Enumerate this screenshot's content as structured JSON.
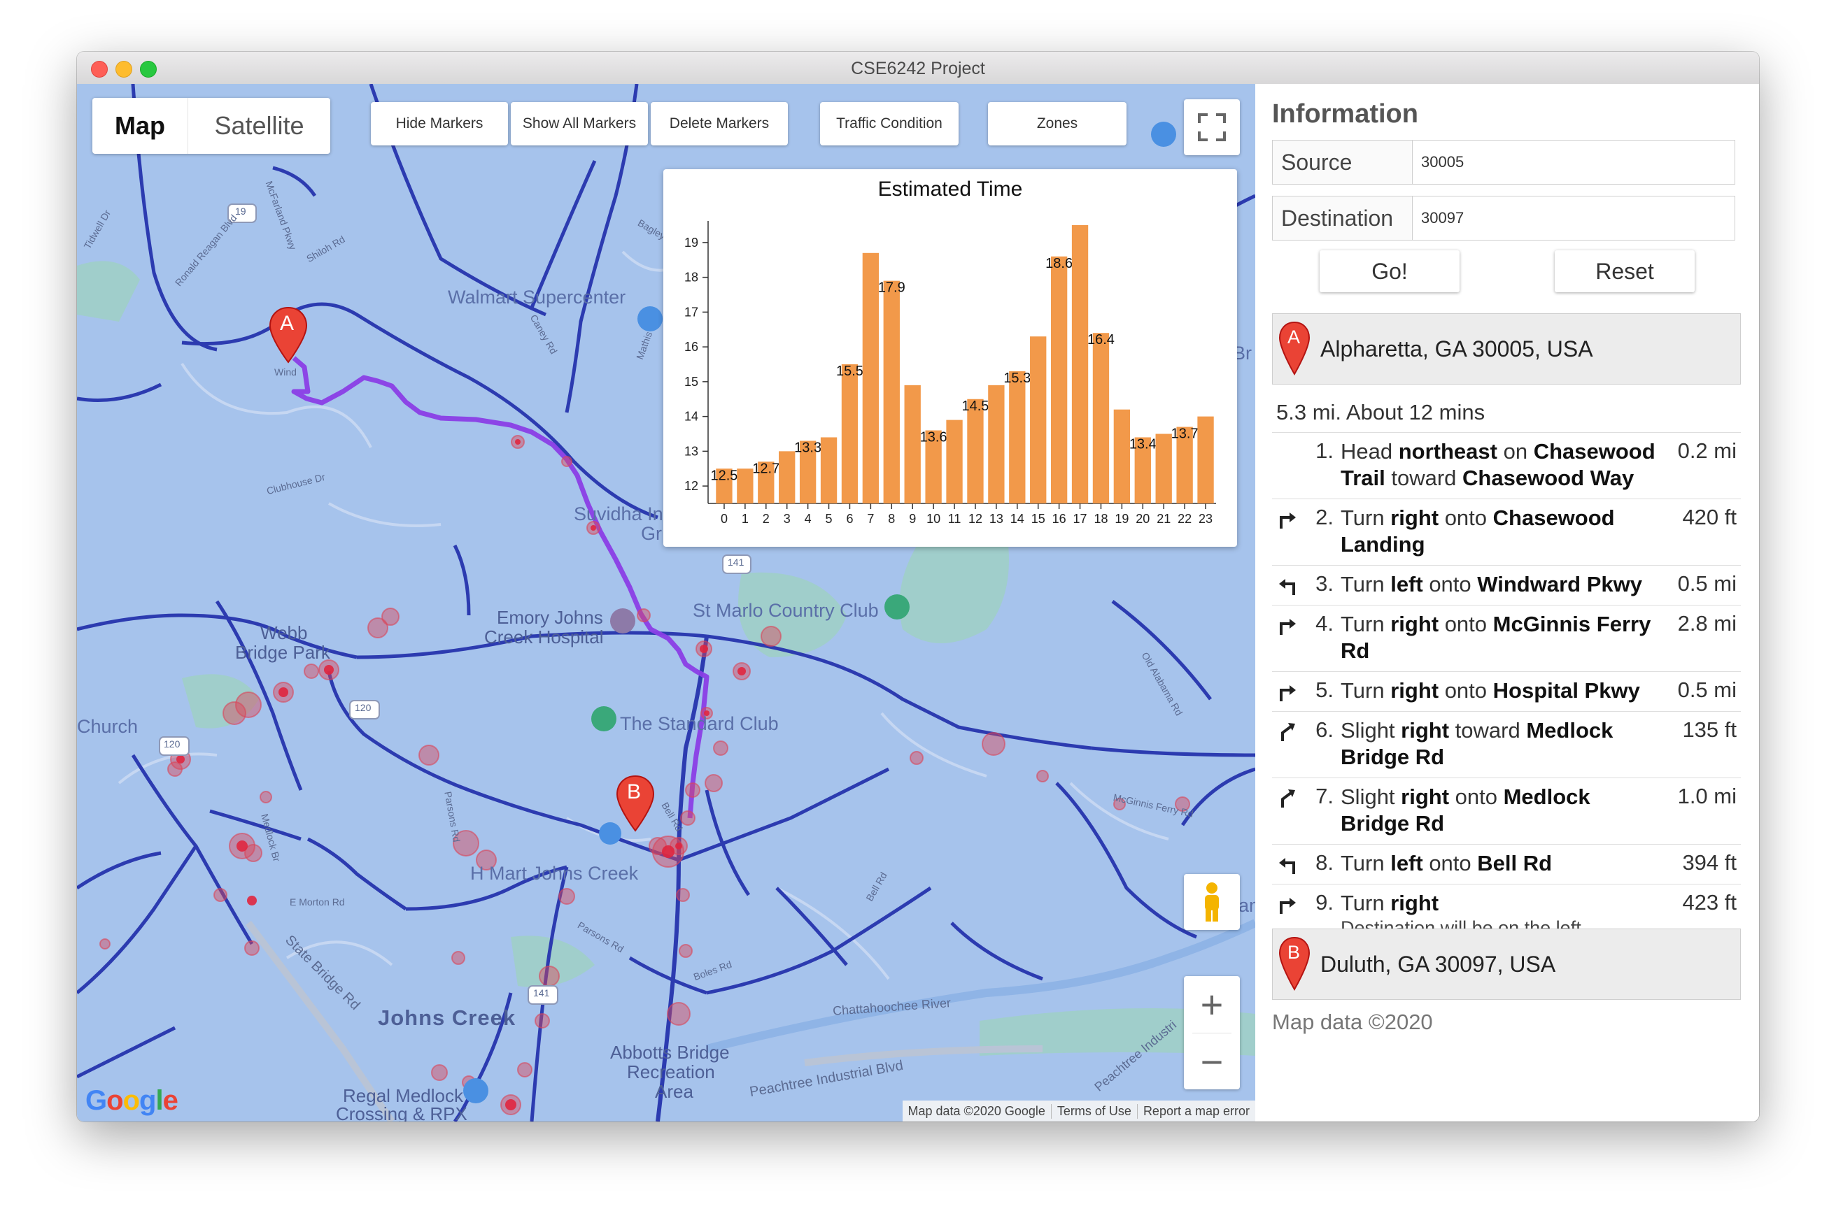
{
  "window": {
    "title": "CSE6242 Project"
  },
  "map_type": {
    "map": "Map",
    "satellite": "Satellite"
  },
  "controls": {
    "hide_markers": "Hide Markers",
    "show_all_markers": "Show All Markers",
    "delete_markers": "Delete Markers",
    "traffic_condition": "Traffic Condition",
    "zones": "Zones"
  },
  "map_labels": {
    "walmart": "Walmart Supercenter",
    "suvidha": "Suvidha In",
    "suvidha2": "Gr",
    "emory1": "Emory Johns",
    "emory2": "Creek Hospital",
    "st_marlo": "St Marlo Country Club",
    "webb1": "Webb",
    "webb2": "Bridge Park",
    "church": "Church",
    "standard": "The Standard Club",
    "hmart": "H Mart Johns Creek",
    "johns_creek": "Johns Creek",
    "abbotts1": "Abbotts Bridge",
    "abbotts2": "Recreation",
    "abbotts3": "Area",
    "regal1": "Regal Medlock",
    "regal2": "Crossing & RPX",
    "peachtree": "Peachtree Industrial Blvd",
    "chattahoochee": "Chattahoochee River",
    "windward": "Wind",
    "clubhouse": "Clubhouse Dr",
    "tidwell": "Tidwell Dr",
    "ronald": "Ronald Reagan Blvd",
    "mcfarland": "McFarland Pkwy",
    "shiloh": "Shiloh Rd",
    "bagley": "Bagley",
    "caney": "Caney Rd",
    "mathis": "Mathis",
    "parsons": "Parsons Rd",
    "parsons2": "Parsons Rd",
    "bell": "Bell Rd",
    "bell2": "Bell Rd",
    "boles": "Boles Rd",
    "state_bridge": "State Bridge Rd",
    "morton": "E Morton Rd",
    "medlock": "Medlock Br",
    "mcginnis": "McGinnis Ferry Rd",
    "old_alabama": "Old Alabama Rd",
    "peachtree2": "Peachtree Industri",
    "route_19": "19",
    "route_141": "141",
    "route_141b": "141",
    "route_120": "120",
    "route_120b": "120",
    "marker_a": "A",
    "marker_b": "B",
    "edge_br": "Br",
    "edge_an": "an"
  },
  "attribution": {
    "map_data": "Map data ©2020 Google",
    "terms": "Terms of Use",
    "report": "Report a map error",
    "google": [
      "G",
      "o",
      "o",
      "g",
      "l",
      "e"
    ]
  },
  "zoom": {
    "plus": "+",
    "minus": "−"
  },
  "chart_data": {
    "type": "bar",
    "title": "Estimated Time",
    "categories": [
      "0",
      "1",
      "2",
      "3",
      "4",
      "5",
      "6",
      "7",
      "8",
      "9",
      "10",
      "11",
      "12",
      "13",
      "14",
      "15",
      "16",
      "17",
      "18",
      "19",
      "20",
      "21",
      "22",
      "23"
    ],
    "values": [
      12.5,
      12.5,
      12.7,
      13.0,
      13.3,
      13.4,
      15.5,
      18.7,
      17.9,
      14.9,
      13.6,
      13.9,
      14.5,
      14.9,
      15.3,
      16.3,
      18.6,
      19.5,
      16.4,
      14.2,
      13.4,
      13.5,
      13.7,
      14.0
    ],
    "labels": {
      "0": "12.5",
      "2": "12.7",
      "4": "13.3",
      "6": "15.5",
      "8": "17.9",
      "10": "13.6",
      "12": "14.5",
      "14": "15.3",
      "16": "18.6",
      "18": "16.4",
      "20": "13.4",
      "22": "13.7"
    },
    "yticks": [
      "12",
      "13",
      "14",
      "15",
      "16",
      "17",
      "18",
      "19"
    ],
    "ylim": [
      11.5,
      19.5
    ],
    "color": "#f2994a"
  },
  "info": {
    "title": "Information",
    "source_label": "Source",
    "source_value": "30005",
    "destination_label": "Destination",
    "destination_value": "30097",
    "go": "Go!",
    "reset": "Reset",
    "start_address": "Alpharetta, GA 30005, USA",
    "start_marker": "A",
    "summary": "5.3 mi. About 12 mins",
    "steps": [
      {
        "num": "1.",
        "icon": "none",
        "pre": "Head ",
        "b1": "northeast",
        "mid": " on ",
        "b2": "Chasewood Trail",
        "mid2": " toward ",
        "b3": "Chasewood Way",
        "dist": "0.2 mi"
      },
      {
        "num": "2.",
        "icon": "turn-right",
        "pre": "Turn ",
        "b1": "right",
        "mid": " onto ",
        "b2": "Chasewood Landing",
        "dist": "420 ft"
      },
      {
        "num": "3.",
        "icon": "turn-left",
        "pre": "Turn ",
        "b1": "left",
        "mid": " onto ",
        "b2": "Windward Pkwy",
        "dist": "0.5 mi"
      },
      {
        "num": "4.",
        "icon": "turn-right",
        "pre": "Turn ",
        "b1": "right",
        "mid": " onto ",
        "b2": "McGinnis Ferry Rd",
        "dist": "2.8 mi"
      },
      {
        "num": "5.",
        "icon": "turn-right",
        "pre": "Turn ",
        "b1": "right",
        "mid": " onto ",
        "b2": "Hospital Pkwy",
        "dist": "0.5 mi"
      },
      {
        "num": "6.",
        "icon": "slight-right",
        "pre": "Slight ",
        "b1": "right",
        "mid": " toward ",
        "b2": "Medlock Bridge Rd",
        "dist": "135 ft"
      },
      {
        "num": "7.",
        "icon": "slight-right",
        "pre": "Slight ",
        "b1": "right",
        "mid": " onto ",
        "b2": "Medlock Bridge Rd",
        "dist": "1.0 mi"
      },
      {
        "num": "8.",
        "icon": "turn-left",
        "pre": "Turn ",
        "b1": "left",
        "mid": " onto ",
        "b2": "Bell Rd",
        "dist": "394 ft"
      },
      {
        "num": "9.",
        "icon": "turn-right",
        "pre": "Turn ",
        "b1": "right",
        "note": "Destination will be on the left",
        "dist": "423 ft"
      }
    ],
    "end_address": "Duluth, GA 30097, USA",
    "end_marker": "B",
    "map_data": "Map data ©2020"
  }
}
